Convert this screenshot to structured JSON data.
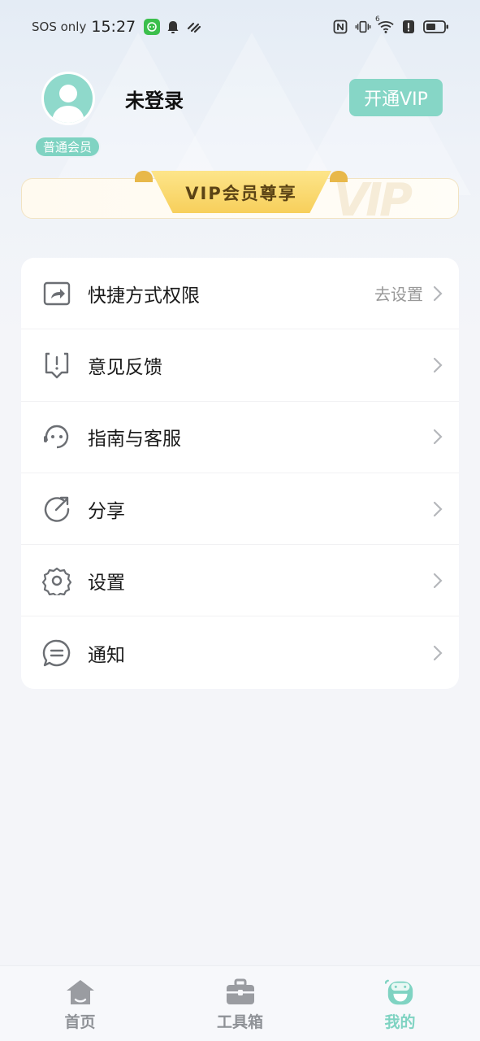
{
  "status_bar": {
    "sos": "SOS only",
    "time": "15:27",
    "network_label": "6"
  },
  "profile": {
    "username": "未登录",
    "member_badge": "普通会员",
    "vip_button": "开通VIP"
  },
  "vip_banner": {
    "ribbon_text": "VIP会员尊享",
    "watermark": "VIP"
  },
  "menu": {
    "items": [
      {
        "label": "快捷方式权限",
        "hint": "去设置",
        "icon": "shortcut-share-icon"
      },
      {
        "label": "意见反馈",
        "hint": "",
        "icon": "feedback-icon"
      },
      {
        "label": "指南与客服",
        "hint": "",
        "icon": "customer-service-icon"
      },
      {
        "label": "分享",
        "hint": "",
        "icon": "share-icon"
      },
      {
        "label": "设置",
        "hint": "",
        "icon": "gear-icon"
      },
      {
        "label": "通知",
        "hint": "",
        "icon": "notification-message-icon"
      }
    ]
  },
  "bottom_nav": {
    "items": [
      {
        "label": "首页",
        "icon": "home-icon",
        "active": false
      },
      {
        "label": "工具箱",
        "icon": "toolbox-icon",
        "active": false
      },
      {
        "label": "我的",
        "icon": "mine-face-icon",
        "active": true
      }
    ]
  },
  "colors": {
    "accent": "#7fd3c2",
    "vip_gold": "#f7cf5b",
    "nav_inactive": "#8e9196"
  }
}
